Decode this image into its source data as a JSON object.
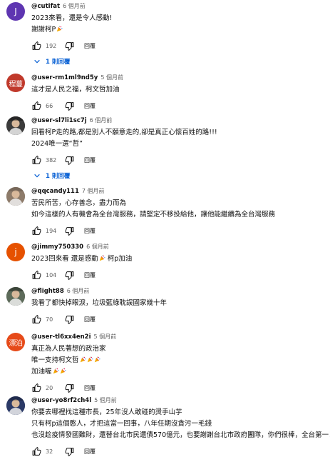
{
  "labels": {
    "reply": "回覆"
  },
  "comments": [
    {
      "author": "@cutifat",
      "time": "6 個月前",
      "avatar": {
        "kind": "letter",
        "text": "J",
        "color": "#5e35b1"
      },
      "lines": [
        "2023來看，還是令人感動!",
        "謝謝柯P🎉"
      ],
      "likes": "192",
      "replies": "1 則回覆"
    },
    {
      "author": "@user-rm1ml9nd5y",
      "time": "5 個月前",
      "avatar": {
        "kind": "letter",
        "text": "程蔓",
        "color": "#c0392b"
      },
      "lines": [
        "這才是人民之福，柯文哲加油"
      ],
      "likes": "66"
    },
    {
      "author": "@user-sl7li1sc7j",
      "time": "6 個月前",
      "avatar": {
        "kind": "photo",
        "color": "#3b3b3b"
      },
      "lines": [
        "回看柯P走的路,都是別人不願意走的,卻是真正心懷百姓的路!!!",
        "2024唯一選“哲”"
      ],
      "likes": "382",
      "replies": "1 則回覆"
    },
    {
      "author": "@qqcandy111",
      "time": "7 個月前",
      "avatar": {
        "kind": "photo",
        "color": "#8d7b6a"
      },
      "lines": [
        "苦民所苦，心存善念，盡力而為",
        "如今這樣的人有機會為全台灣服務，請堅定不移投給他，讓他能繼續為全台灣服務"
      ],
      "likes": "194"
    },
    {
      "author": "@jimmy750330",
      "time": "6 個月前",
      "avatar": {
        "kind": "letter",
        "text": "j",
        "color": "#e65100"
      },
      "lines": [
        "2023回來看 還是感動🎉 柯p加油"
      ],
      "likes": "104"
    },
    {
      "author": "@flight88",
      "time": "6 個月前",
      "avatar": {
        "kind": "photo",
        "color": "#5d6b5a"
      },
      "lines": [
        "我看了都快掉眼淚，垃圾藍綠耽誤國家幾十年"
      ],
      "likes": "70"
    },
    {
      "author": "@user-tl6xx4en2i",
      "time": "5 個月前",
      "avatar": {
        "kind": "letter",
        "text": "漂泊",
        "color": "#e64a19"
      },
      "lines": [
        "真正為人民著想的政治家",
        "唯一支持柯文哲🎉🎉🎉",
        "加油喔🎉🎉"
      ],
      "likes": "20"
    },
    {
      "author": "@user-yo8rf2ch4l",
      "time": "5 個月前",
      "avatar": {
        "kind": "photo",
        "color": "#2b3a67"
      },
      "lines": [
        "你要去哪裡找這種市長，25年沒人敢碰的燙手山芋",
        "只有柯p這個憨人，才把這當一回事，八年任期沒貪污一毛錢",
        "也沒趁疫情發國難財，還替台北市民還債570億元，也要謝謝台北市政府團隊，你們很棒，全台第一！"
      ],
      "likes": "32"
    }
  ]
}
